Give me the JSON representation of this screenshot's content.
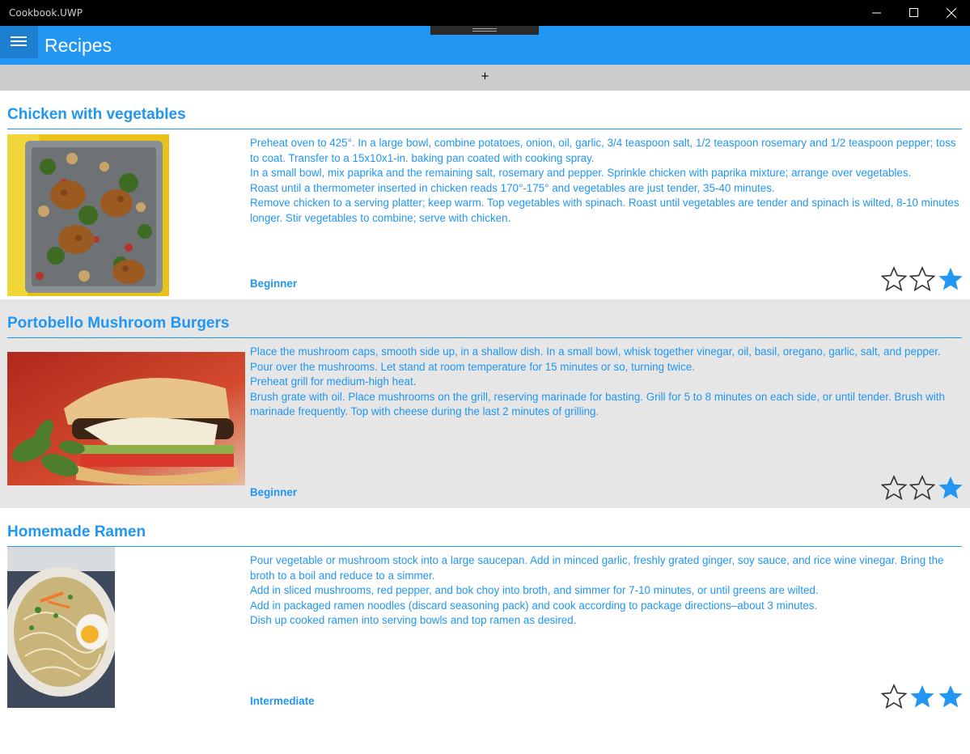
{
  "window": {
    "title": "Cookbook.UWP"
  },
  "appbar": {
    "title": "Recipes"
  },
  "toolbar": {
    "add_label": "+"
  },
  "colors": {
    "accent": "#2196f3",
    "alt_row": "#e6e6e6",
    "star_empty": "#333333"
  },
  "recipes": [
    {
      "name": "Chicken with vegetables",
      "image": "roasted-chicken-vegetables-photo",
      "instructions": [
        "Preheat oven to 425°. In a large bowl, combine potatoes, onion, oil, garlic, 3/4 teaspoon salt, 1/2 teaspoon rosemary and 1/2 teaspoon pepper; toss to coat. Transfer to a 15x10x1-in. baking pan coated with cooking spray.",
        "In a small bowl, mix paprika and the remaining salt, rosemary and pepper. Sprinkle chicken with paprika mixture; arrange over vegetables.",
        "Roast until a thermometer inserted in chicken reads 170°-175° and vegetables are just tender, 35-40 minutes.",
        "Remove chicken to a serving platter; keep warm. Top vegetables with spinach. Roast until vegetables are tender and spinach is wilted, 8-10 minutes longer. Stir vegetables to combine; serve with chicken."
      ],
      "level": "Beginner",
      "rating": 1,
      "rating_max": 3
    },
    {
      "name": "Portobello Mushroom Burgers",
      "image": "mushroom-burger-photo",
      "instructions": [
        "Place the mushroom caps, smooth side up, in a shallow dish. In a small bowl, whisk together vinegar, oil, basil, oregano, garlic, salt, and pepper. Pour over the mushrooms. Let stand at room temperature for 15 minutes or so, turning twice.",
        "Preheat grill for medium-high heat.",
        "Brush grate with oil. Place mushrooms on the grill, reserving marinade for basting. Grill for 5 to 8 minutes on each side, or until tender. Brush with marinade frequently. Top with cheese during the last 2 minutes of grilling."
      ],
      "level": "Beginner",
      "rating": 1,
      "rating_max": 3
    },
    {
      "name": "Homemade Ramen",
      "image": "ramen-bowl-photo",
      "instructions": [
        "Pour vegetable or mushroom stock into a large saucepan. Add in minced garlic, freshly grated ginger, soy sauce, and rice wine vinegar. Bring the broth to a boil and reduce to a simmer.",
        "Add in sliced mushrooms, red pepper, and bok choy into broth, and simmer for 7-10 minutes, or until greens are wilted.",
        "Add in packaged ramen noodles (discard seasoning pack) and cook according to package directions–about 3 minutes.",
        "Dish up cooked ramen into serving bowls and top ramen as desired."
      ],
      "level": "Intermediate",
      "rating": 2,
      "rating_max": 3
    }
  ]
}
